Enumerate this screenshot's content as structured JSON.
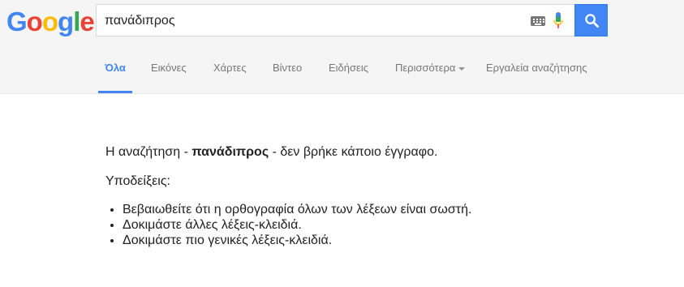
{
  "logo": {
    "letters": [
      "G",
      "o",
      "o",
      "g",
      "l",
      "e"
    ],
    "colors": [
      "#4285f4",
      "#ea4335",
      "#fbbc05",
      "#4285f4",
      "#34a853",
      "#ea4335"
    ]
  },
  "search": {
    "query": "πανάδιπρος"
  },
  "tabs": [
    {
      "label": "Όλα",
      "active": true
    },
    {
      "label": "Εικόνες"
    },
    {
      "label": "Χάρτες"
    },
    {
      "label": "Βίντεο"
    },
    {
      "label": "Ειδήσεις"
    },
    {
      "label": "Περισσότερα"
    },
    {
      "label": "Εργαλεία αναζήτησης"
    }
  ],
  "results": {
    "no_results_prefix": "Η αναζήτηση - ",
    "no_results_query": "πανάδιπρος",
    "no_results_suffix": " - δεν βρήκε κάποιο έγγραφο.",
    "suggestions_label": "Υποδείξεις:",
    "suggestions": [
      "Βεβαιωθείτε ότι η ορθογραφία όλων των λέξεων είναι σωστή.",
      "Δοκιμάστε άλλες λέξεις-κλειδιά.",
      "Δοκιμάστε πιο γενικές λέξεις-κλειδιά."
    ]
  },
  "colors": {
    "accent": "#4285f4",
    "tab_inactive": "#777777"
  }
}
